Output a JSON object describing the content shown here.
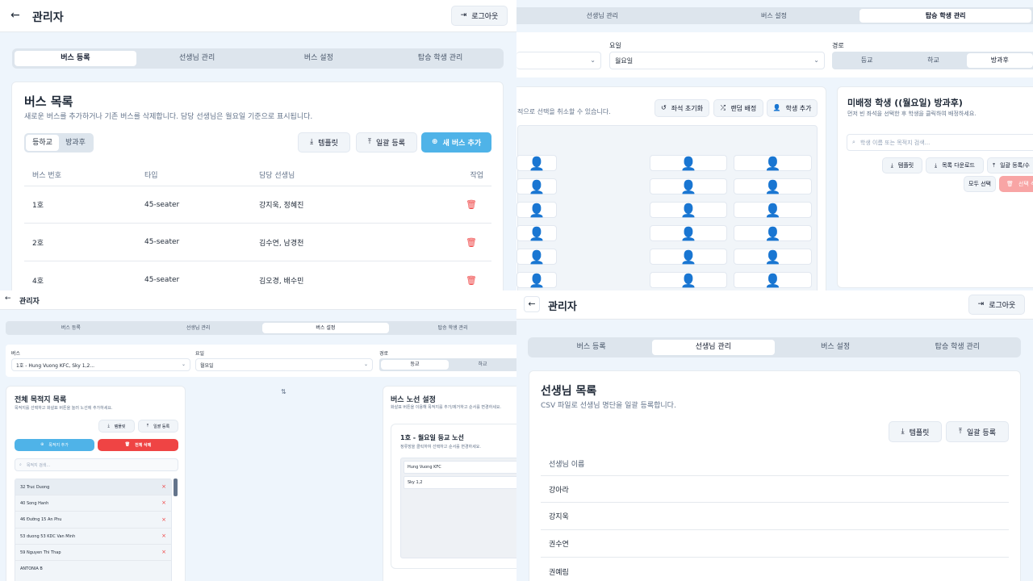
{
  "q1": {
    "header": {
      "title": "관리자",
      "logout_label": "로그아웃"
    },
    "tabs": [
      "버스 등록",
      "선생님 관리",
      "버스 설정",
      "탑승 학생 관리"
    ],
    "card": {
      "title": "버스 목록",
      "subtitle": "새로운 버스를 추가하거나 기존 버스를 삭제합니다. 담당 선생님은 월요일 기준으로 표시됩니다.",
      "toggle": [
        "등하교",
        "방과후"
      ],
      "template_label": "템플릿",
      "bulk_label": "일괄 등록",
      "add_label": "새 버스 추가",
      "columns": [
        "버스 번호",
        "타입",
        "담당 선생님",
        "작업"
      ],
      "rows": [
        {
          "bus": "1호",
          "type": "45-seater",
          "teachers": "강지욱, 정혜진"
        },
        {
          "bus": "2호",
          "type": "45-seater",
          "teachers": "김수연, 남경천"
        },
        {
          "bus": "4호",
          "type": "45-seater",
          "teachers": "김오경, 배수민"
        }
      ]
    }
  },
  "q2": {
    "tabs": [
      "선생님 관리",
      "버스 설정",
      "탑승 학생 관리"
    ],
    "day_label": "요일",
    "day_value": "월요일",
    "route_label": "경로",
    "route_options": [
      "등교",
      "하교",
      "방과후"
    ],
    "seat_hint": "적으로 선택을 취소할 수 있습니다.",
    "reset_label": "좌석 초기화",
    "random_label": "랜덤 배정",
    "add_student_label": "학생 추가",
    "unassigned_title": "미배정 학생 ((월요일) 방과후)",
    "unassigned_hint": "먼저 빈 좌석을 선택한 후 학생을 클릭하여 배정하세요.",
    "search_placeholder": "학생 이름 또는 목적지 검색...",
    "template_label": "템플릿",
    "download_label": "목록 다운로드",
    "bulk_label": "일괄 등록/수",
    "select_all_label": "모두 선택",
    "delete_selected_label": "선택 삭"
  },
  "q3": {
    "header": {
      "title": "관리자"
    },
    "tabs": [
      "버스 등록",
      "선생님 관리",
      "버스 설정",
      "탑승 학생 관리"
    ],
    "bus_label": "버스",
    "bus_value": "1호 - Hung Vuong KFC, Sky 1,2...",
    "day_label": "요일",
    "day_value": "월요일",
    "route_label": "경로",
    "route_options": [
      "등교",
      "하교"
    ],
    "dest": {
      "title": "전체 목적지 목록",
      "hint": "목적지를 선택하고 화살표 버튼을 눌러 노선에 추가하세요.",
      "template_label": "템플릿",
      "bulk_label": "일괄 등록",
      "add_label": "목적지 추가",
      "delete_all_label": "전체 삭제",
      "search_placeholder": "목적지 검색...",
      "items": [
        "32 Truc Duong",
        "40 Song Hanh",
        "46 Đường 15 An Phu",
        "53 duong 53 KDC Van Minh",
        "59 Nguyen Thi Thap",
        "ANTONIA B"
      ]
    },
    "route": {
      "title": "버스 노선 설정",
      "hint": "화살표 버튼을 이용해 목적지를 추가/제거하고 순서를 변경하세요.",
      "subtitle": "1호 - 월요일 등교 노선",
      "subhint": "정류장을 클릭하여 선택하고 순서를 변경하세요.",
      "stops": [
        "Hung Vuong KFC",
        "Sky 1,2"
      ]
    }
  },
  "q4": {
    "header": {
      "title": "관리자",
      "logout_label": "로그아웃"
    },
    "tabs": [
      "버스 등록",
      "선생님 관리",
      "버스 설정",
      "탑승 학생 관리"
    ],
    "card": {
      "title": "선생님 목록",
      "subtitle": "CSV 파일로 선생님 명단을 일괄 등록합니다.",
      "template_label": "템플릿",
      "bulk_label": "일괄 등록",
      "column": "선생님 이름",
      "teachers": [
        "강아라",
        "강지욱",
        "권수연",
        "권예림"
      ]
    }
  }
}
